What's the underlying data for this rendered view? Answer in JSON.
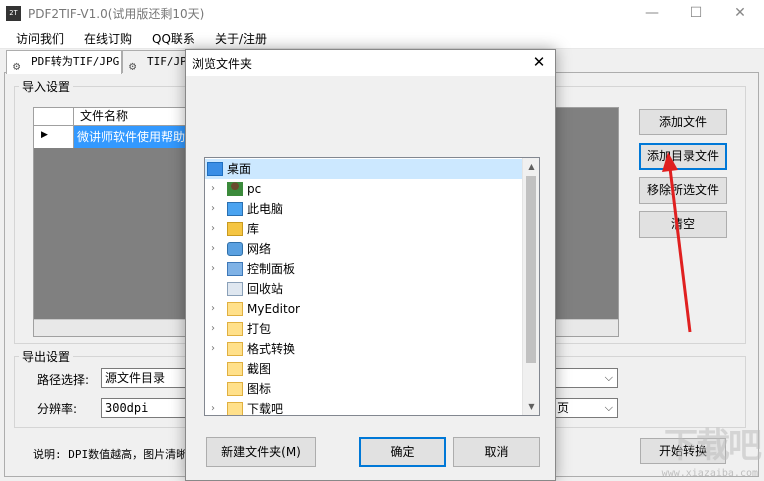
{
  "window": {
    "icon_text": "2T",
    "title": "PDF2TIF-V1.0(试用版还剩10天)",
    "minimize": "—",
    "maximize": "☐",
    "close": "✕"
  },
  "menu": [
    "访问我们",
    "在线订购",
    "QQ联系",
    "关于/注册"
  ],
  "tabs": [
    {
      "label": "PDF转为TIF/JPG",
      "active": true
    },
    {
      "label": "TIF/JPG",
      "active": false
    }
  ],
  "import_settings": {
    "label": "导入设置",
    "grid": {
      "column_header": "文件名称",
      "row_indicator": "▶",
      "rows": [
        "微讲师软件使用帮助"
      ]
    },
    "buttons": {
      "add_file": "添加文件",
      "add_folder": "添加目录文件",
      "remove_selected": "移除所选文件",
      "clear": "清空"
    }
  },
  "export_settings": {
    "label": "导出设置",
    "path_label": "路径选择:",
    "path_value": "源文件目录",
    "resolution_label": "分辨率:",
    "resolution_value": "300dpi",
    "right_combo_tail": "页"
  },
  "hint": "说明: DPI数值越高，图片清晰",
  "start_button": "开始转换",
  "watermark": {
    "main": "下载吧",
    "sub": "www.xiazaiba.com"
  },
  "dialog": {
    "title": "浏览文件夹",
    "close": "✕",
    "tree": [
      {
        "label": "桌面",
        "icon": "desktop-icon",
        "expandable": false,
        "selected": true,
        "indent": 0
      },
      {
        "label": "pc",
        "icon": "user-icon",
        "expandable": true,
        "selected": false,
        "indent": 1
      },
      {
        "label": "此电脑",
        "icon": "computer-icon",
        "expandable": true,
        "selected": false,
        "indent": 1
      },
      {
        "label": "库",
        "icon": "library-icon",
        "expandable": true,
        "selected": false,
        "indent": 1
      },
      {
        "label": "网络",
        "icon": "network-icon",
        "expandable": true,
        "selected": false,
        "indent": 1
      },
      {
        "label": "控制面板",
        "icon": "control-panel-icon",
        "expandable": true,
        "selected": false,
        "indent": 1
      },
      {
        "label": "回收站",
        "icon": "recycle-bin-icon",
        "expandable": false,
        "selected": false,
        "indent": 1
      },
      {
        "label": "MyEditor",
        "icon": "folder-icon",
        "expandable": true,
        "selected": false,
        "indent": 1
      },
      {
        "label": "打包",
        "icon": "folder-icon",
        "expandable": true,
        "selected": false,
        "indent": 1
      },
      {
        "label": "格式转换",
        "icon": "folder-icon",
        "expandable": true,
        "selected": false,
        "indent": 1
      },
      {
        "label": "截图",
        "icon": "folder-icon",
        "expandable": false,
        "selected": false,
        "indent": 1
      },
      {
        "label": "图标",
        "icon": "folder-icon",
        "expandable": false,
        "selected": false,
        "indent": 1
      },
      {
        "label": "下载吧",
        "icon": "folder-icon",
        "expandable": true,
        "selected": false,
        "indent": 1
      }
    ],
    "buttons": {
      "new_folder": "新建文件夹(M)",
      "ok": "确定",
      "cancel": "取消"
    }
  },
  "colors": {
    "selection": "#3399ff",
    "tree_selection": "#cce8ff",
    "accent_focus": "#0078d7",
    "annotation_arrow": "#e02020"
  }
}
